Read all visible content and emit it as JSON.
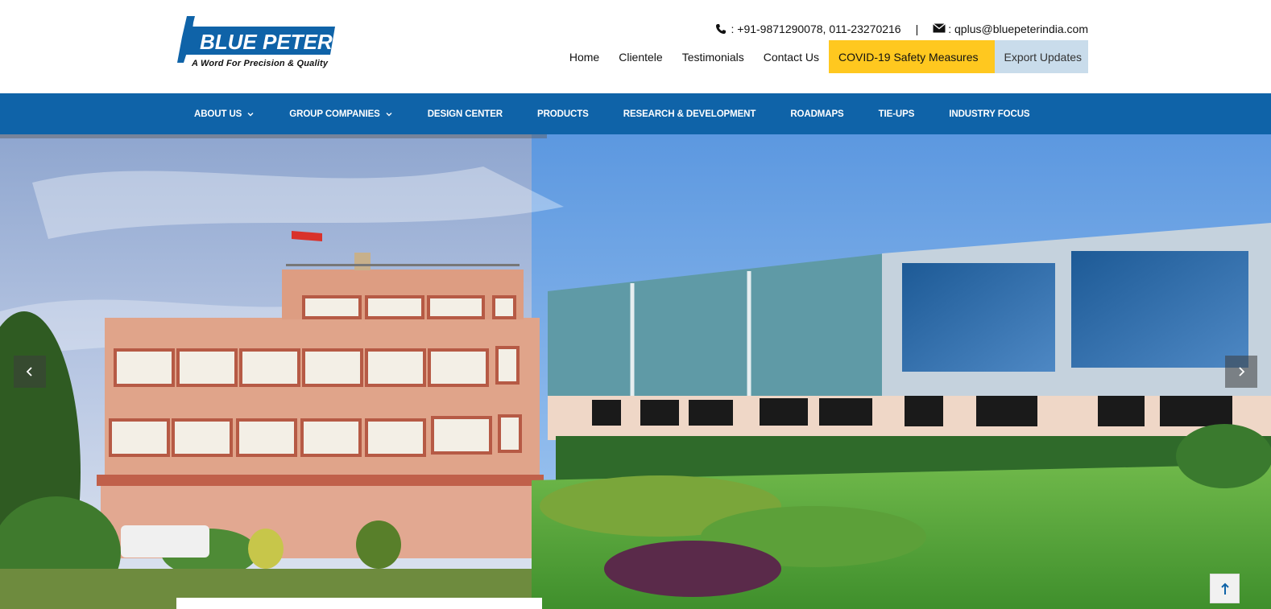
{
  "brand": {
    "name": "BLUE PETER",
    "tagline": "A Word For Precision & Quality"
  },
  "contact": {
    "phone_icon": "phone-icon",
    "phone": ": +91-9871290078, 011-23270216",
    "separator": "|",
    "email_icon": "envelope-icon",
    "email": ": qplus@bluepeterindia.com"
  },
  "topnav": {
    "items": [
      {
        "label": "Home"
      },
      {
        "label": "Clientele"
      },
      {
        "label": "Testimonials"
      },
      {
        "label": "Contact Us"
      },
      {
        "label": "COVID-19 Safety Measures"
      },
      {
        "label": "Export Updates"
      }
    ]
  },
  "mainnav": {
    "items": [
      {
        "label": "ABOUT US",
        "has_dropdown": true
      },
      {
        "label": "GROUP COMPANIES",
        "has_dropdown": true
      },
      {
        "label": "DESIGN CENTER",
        "has_dropdown": false
      },
      {
        "label": "PRODUCTS",
        "has_dropdown": false
      },
      {
        "label": "RESEARCH & DEVELOPMENT",
        "has_dropdown": false
      },
      {
        "label": "ROADMAPS",
        "has_dropdown": false
      },
      {
        "label": "TIE-UPS",
        "has_dropdown": false
      },
      {
        "label": "INDUSTRY FOCUS",
        "has_dropdown": false
      }
    ]
  },
  "slider": {
    "progress_fraction": 0.43,
    "prev_icon": "chevron-left-icon",
    "next_icon": "chevron-right-icon",
    "scroll_top_icon": "arrow-up-icon"
  },
  "colors": {
    "brand_blue": "#0f63a8",
    "covid_yellow": "#ffc81f",
    "export_bg": "#c9dceb"
  }
}
